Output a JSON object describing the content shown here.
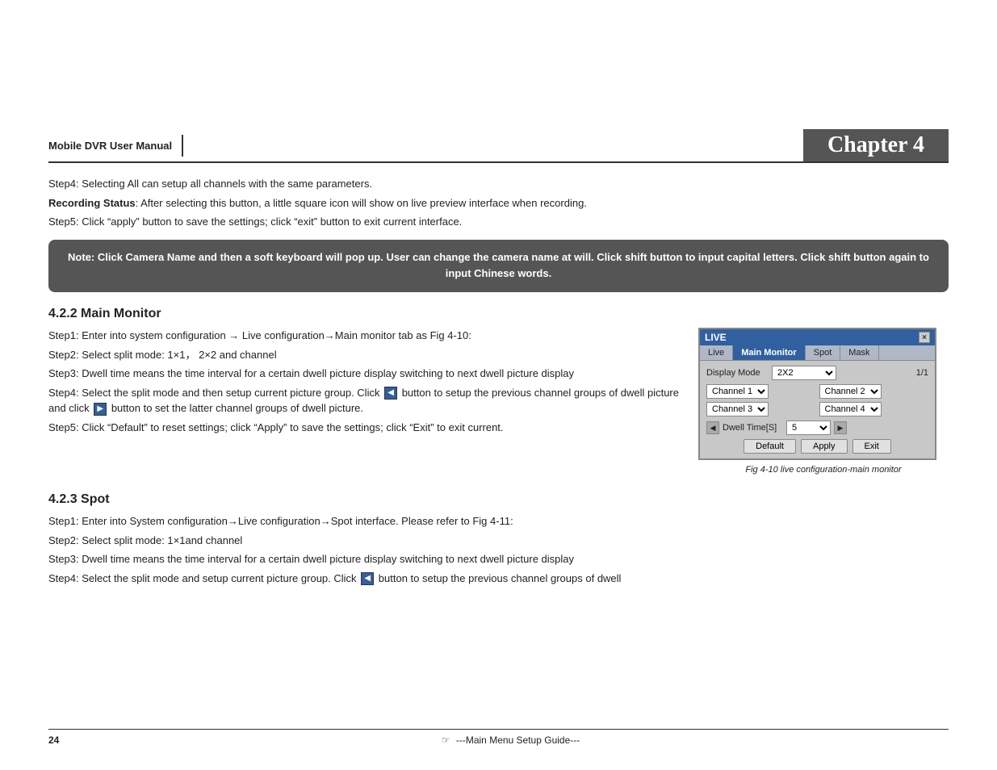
{
  "header": {
    "manual_title": "Mobile DVR User Manual",
    "chapter_label": "Chapter 4"
  },
  "content": {
    "step4_all": "Step4: Selecting All can setup all channels with the same parameters.",
    "recording_status_label": "Recording Status",
    "recording_status_text": ": After selecting this button, a little square icon will show on live preview interface when recording.",
    "step5_apply": "Step5: Click “apply” button to save the settings; click “exit” button to exit current interface.",
    "note_text": "Note: Click Camera Name and then a soft keyboard will pop up. User can change the camera name at will. Click shift button to input capital letters. Click shift button again to input Chinese words.",
    "section_422": {
      "heading": "4.2.2  Main Monitor",
      "step1": "Step1: Enter into system configuration → Live configuration→Main monitor tab as Fig 4-10:",
      "step2": "Step2: Select split mode: 1×1， 2×2 and channel",
      "step3": "Step3: Dwell time means the time interval for a certain dwell picture display switching to next dwell picture display",
      "step4": "Step4: Select the split mode and then setup current picture group. Click",
      "step4b": "button to setup the previous channel groups of dwell picture and click",
      "step4c": "button to set the latter channel groups of dwell picture.",
      "step5": "Step5: Click “Default” to reset settings; click “Apply” to save the settings; click “Exit” to exit current.",
      "figure_caption": "Fig 4-10 live configuration-main monitor"
    },
    "section_423": {
      "heading": "4.2.3  Spot",
      "step1": "Step1: Enter into System configuration→Live configuration→Spot interface. Please refer to Fig 4-11:",
      "step2": "Step2: Select split mode: 1×1and channel",
      "step3": "Step3: Dwell time means the time interval for a certain dwell picture display switching to next dwell picture display",
      "step4_start": "Step4: Select the split mode and setup current picture group. Click",
      "step4_end": "button to setup the previous channel groups of dwell"
    }
  },
  "live_dialog": {
    "title": "LIVE",
    "close_label": "×",
    "tabs": [
      "Live",
      "Main Monitor",
      "Spot",
      "Mask"
    ],
    "active_tab": "Main Monitor",
    "display_mode_label": "Display Mode",
    "display_mode_value": "2X2",
    "counter": "1/1",
    "channels": [
      {
        "label": "Channel 1"
      },
      {
        "label": "Channel 2"
      },
      {
        "label": "Channel 3"
      },
      {
        "label": "Channel 4"
      }
    ],
    "dwell_label": "Dwell Time[S]",
    "dwell_value": "5",
    "buttons": {
      "default": "Default",
      "apply": "Apply",
      "exit": "Exit"
    }
  },
  "footer": {
    "page_number": "24",
    "bullet": "☞",
    "center_text": "---Main Menu Setup Guide---"
  }
}
